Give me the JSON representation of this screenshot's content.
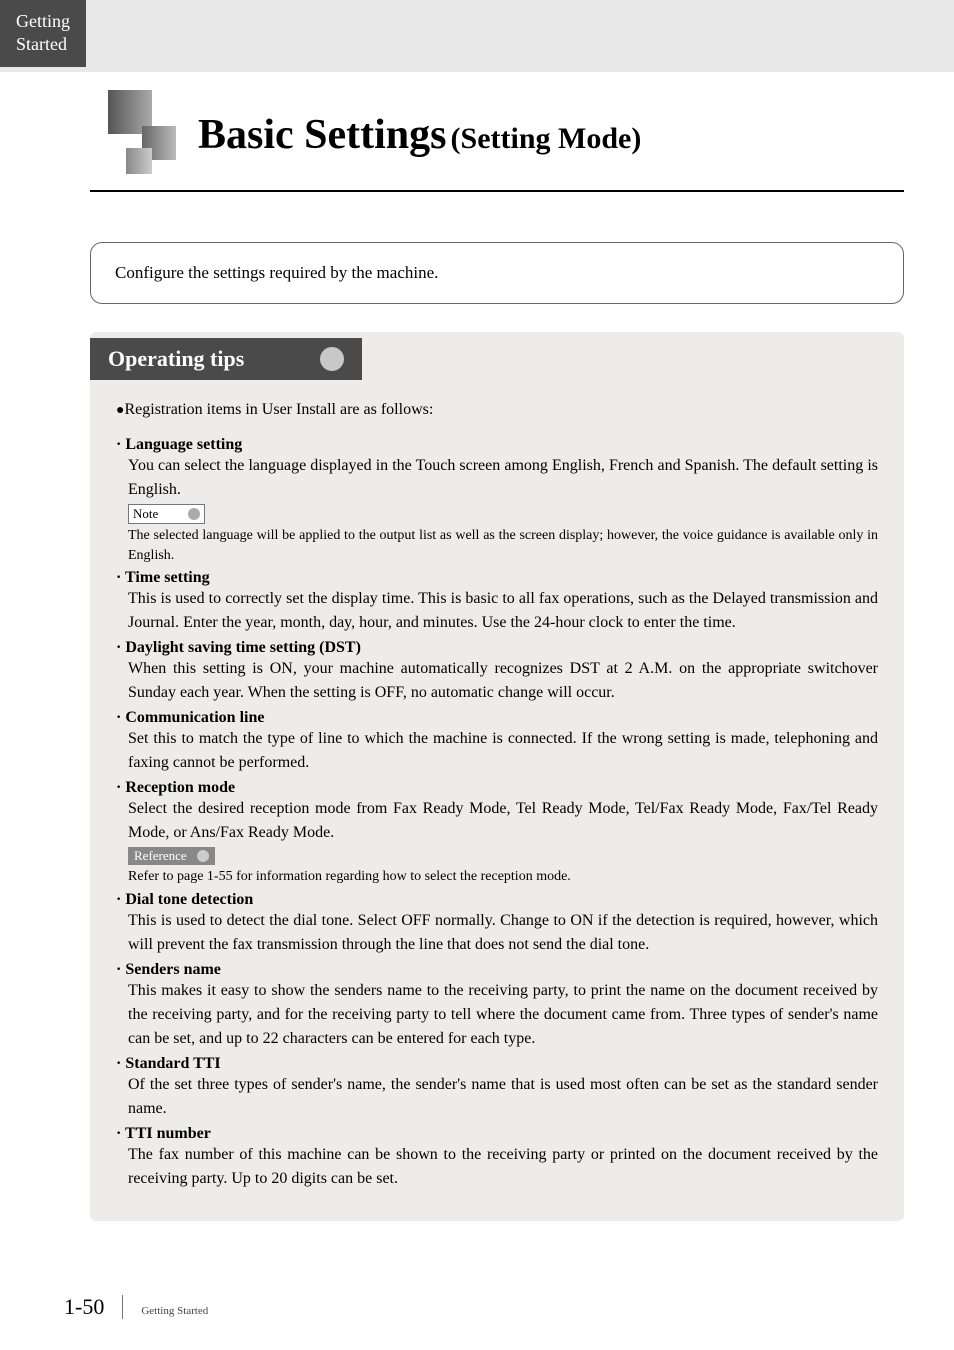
{
  "tab": {
    "line1": "Getting",
    "line2": "Started"
  },
  "title": {
    "main": "Basic Settings",
    "sub": "(Setting Mode)"
  },
  "intro": "Configure the settings required by the machine.",
  "tips": {
    "heading": "Operating tips",
    "bullet_intro": "Registration items in User Install are as follows:",
    "note_label": "Note",
    "reference_label": "Reference",
    "items": [
      {
        "title": "· Language setting",
        "desc": "You can select the language displayed in the Touch screen among English, French and Spanish. The default setting is English.",
        "note": "The selected language will be applied to the output list as well as the screen display; however, the voice guidance is available only in English."
      },
      {
        "title": "· Time setting",
        "desc": "This is used to correctly set the display time. This is basic to all fax operations, such as the Delayed transmission and Journal. Enter the year, month, day, hour, and minutes. Use the 24-hour clock to enter the time."
      },
      {
        "title": "· Daylight saving time setting (DST)",
        "desc": "When this setting is ON, your machine automatically recognizes DST at 2 A.M. on the appropriate switchover Sunday each year. When the setting is OFF, no automatic change will occur."
      },
      {
        "title": "· Communication line",
        "desc": "Set this to match the type of line to which the machine is connected. If the wrong setting is made, telephoning and faxing cannot be performed."
      },
      {
        "title": "· Reception mode",
        "desc": "Select the desired reception mode from Fax Ready Mode, Tel Ready Mode, Tel/Fax Ready Mode, Fax/Tel Ready Mode, or Ans/Fax Ready Mode.",
        "reference": "Refer to page 1-55 for information regarding how to select the reception mode."
      },
      {
        "title": "· Dial tone detection",
        "desc": "This is used to detect the dial tone. Select OFF normally. Change to ON if the detection is required, however, which will prevent the fax transmission through the line that does not send the dial tone."
      },
      {
        "title": "· Senders name",
        "desc": "This makes it easy to show the senders name to the receiving party, to print the name on the document received by the receiving party, and for the receiving party to tell where the document came from. Three types of sender's name can be set, and up to 22 characters can be entered for each type."
      },
      {
        "title": "· Standard TTI",
        "desc": "Of the set three types of sender's name, the sender's name that is used most often can be set as the standard sender name."
      },
      {
        "title": "· TTI number",
        "desc": "The fax number of this machine can be shown to the receiving party or printed on the document received by the receiving party. Up to 20 digits can be set."
      }
    ]
  },
  "footer": {
    "page": "1-50",
    "chapter": "Getting Started"
  }
}
